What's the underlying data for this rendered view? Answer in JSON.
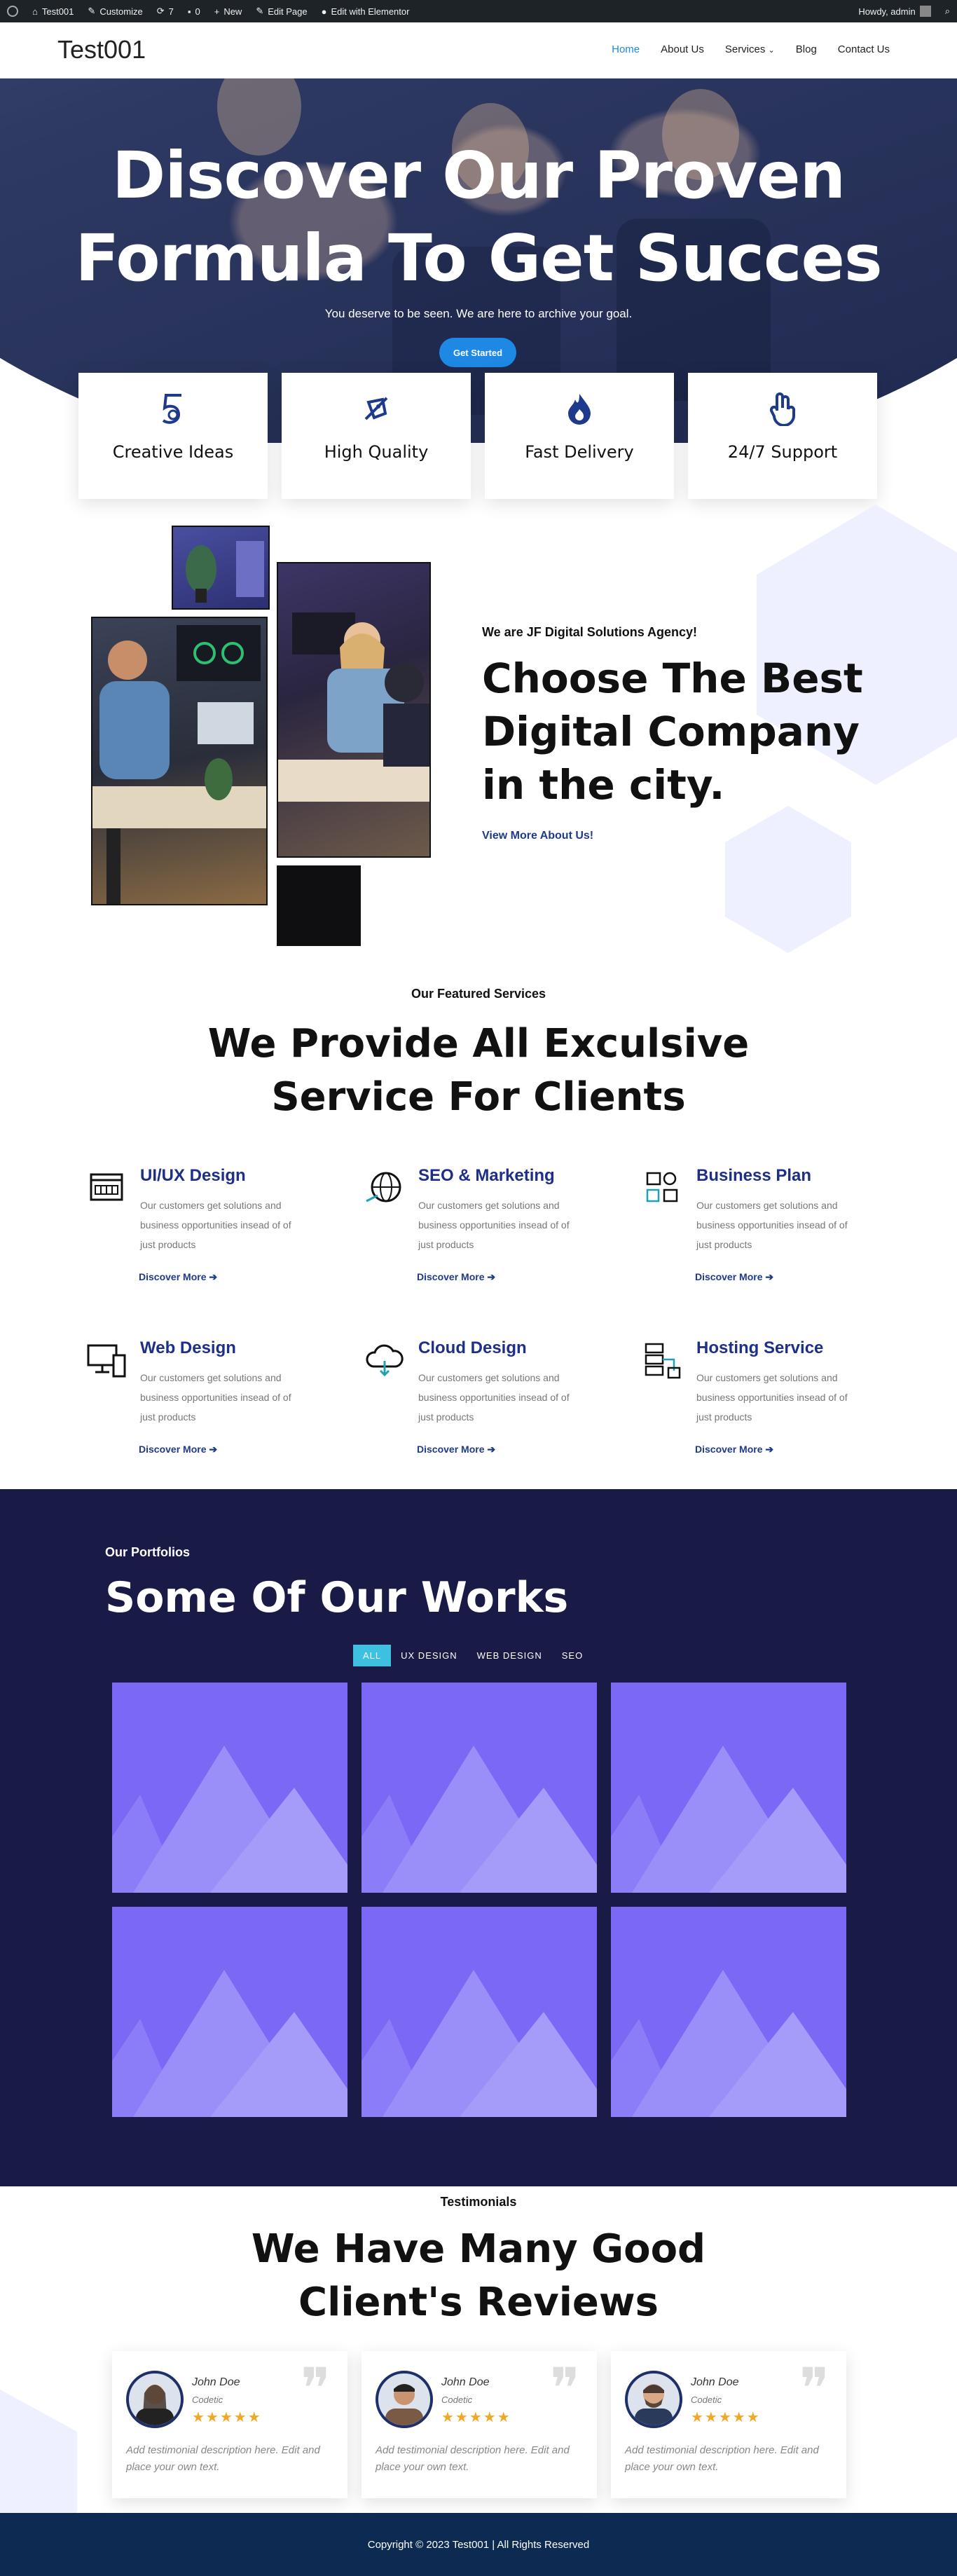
{
  "adminbar": {
    "site": "Test001",
    "customize": "Customize",
    "updates": "7",
    "comments": "0",
    "new": "New",
    "edit_page": "Edit Page",
    "edit_elementor": "Edit with Elementor",
    "howdy": "Howdy, admin"
  },
  "header": {
    "site_title": "Test001",
    "nav": [
      "Home",
      "About Us",
      "Services",
      "Blog",
      "Contact Us"
    ]
  },
  "hero": {
    "title_line1": "Discover Our Proven",
    "title_line2": "Formula To Get Succes",
    "subtitle": "You deserve to be seen. We are here to archive your goal.",
    "button": "Get Started"
  },
  "features": [
    "Creative Ideas",
    "High Quality",
    "Fast Delivery",
    "24/7 Support"
  ],
  "about": {
    "pre": "We are JF Digital Solutions Agency!",
    "title": "Choose The Best Digital Company in the city.",
    "link": "View More About Us!"
  },
  "services": {
    "pre": "Our Featured Services",
    "title_line1": "We Provide All Exculsive",
    "title_line2": "Service For Clients",
    "items": [
      {
        "title": "UI/UX Design",
        "desc": "Our customers get solutions and business opportunities insead of of just products",
        "link": "Discover More"
      },
      {
        "title": "SEO & Marketing",
        "desc": "Our customers get solutions and business opportunities insead of of just products",
        "link": "Discover More"
      },
      {
        "title": "Business Plan",
        "desc": "Our customers get solutions and business opportunities insead of of just products",
        "link": "Discover More"
      },
      {
        "title": "Web Design",
        "desc": "Our customers get solutions and business opportunities insead of of just products",
        "link": "Discover More"
      },
      {
        "title": "Cloud Design",
        "desc": "Our customers get solutions and business opportunities insead of of just products",
        "link": "Discover More"
      },
      {
        "title": "Hosting Service",
        "desc": "Our customers get solutions and business opportunities insead of of just products",
        "link": "Discover More"
      }
    ]
  },
  "portfolio": {
    "pre": "Our Portfolios",
    "title": "Some Of Our Works",
    "filters": [
      "ALL",
      "UX DESIGN",
      "WEB DESIGN",
      "SEO"
    ]
  },
  "testimonials": {
    "pre": "Testimonials",
    "title_line1": "We Have Many Good",
    "title_line2": "Client's Reviews",
    "items": [
      {
        "name": "John Doe",
        "role": "Codetic",
        "stars": "★★★★★",
        "text": "Add testimonial description here. Edit and place your own text."
      },
      {
        "name": "John Doe",
        "role": "Codetic",
        "stars": "★★★★★",
        "text": "Add testimonial description here. Edit and place your own text."
      },
      {
        "name": "John Doe",
        "role": "Codetic",
        "stars": "★★★★★",
        "text": "Add testimonial description here. Edit and place your own text."
      }
    ]
  },
  "footer": {
    "copyright": "Copyright © 2023 Test001 | All Rights Reserved"
  }
}
